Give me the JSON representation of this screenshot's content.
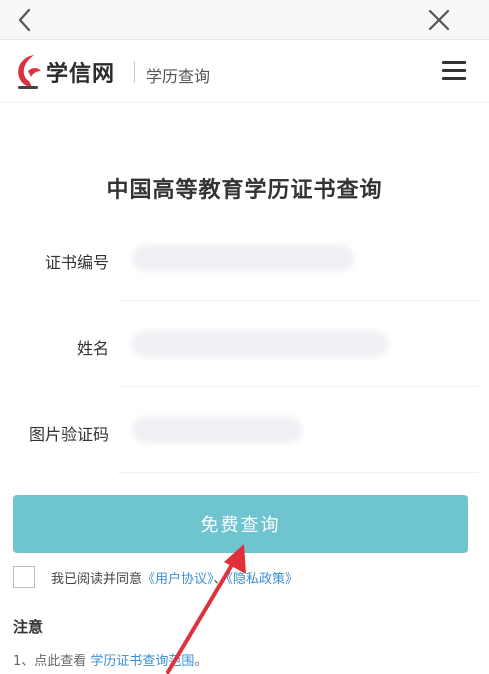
{
  "header": {
    "logo_text": "学信网",
    "logo_sub": "学历查询"
  },
  "page": {
    "title": "中国高等教育学历证书查询"
  },
  "form": {
    "fields": [
      {
        "label": "证书编号"
      },
      {
        "label": "姓名"
      },
      {
        "label": "图片验证码"
      }
    ],
    "submit_label": "免费查询",
    "agree_prefix": "我已阅读并同意",
    "agree_link1": "《用户协议》",
    "agree_sep": "、",
    "agree_link2": "《隐私政策》"
  },
  "notice": {
    "title": "注意",
    "line1_prefix": "1、点此查看",
    "line1_link": "学历证书查询范围",
    "line1_suffix": "。"
  },
  "colors": {
    "button": "#6ec4cf",
    "link": "#3a8fd6",
    "logo_red": "#d9333f",
    "arrow": "#e0313a"
  },
  "icons": [
    "back-arrow-icon",
    "close-icon",
    "xuexin-logo-icon",
    "menu-icon"
  ]
}
